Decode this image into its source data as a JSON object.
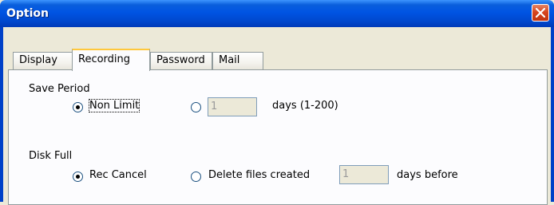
{
  "window": {
    "title": "Option"
  },
  "tabs": [
    {
      "label": "Display",
      "active": false
    },
    {
      "label": "Recording",
      "active": true
    },
    {
      "label": "Password",
      "active": false
    },
    {
      "label": "Mail",
      "active": false
    }
  ],
  "save_period": {
    "heading": "Save Period",
    "option_non_limit": {
      "label": "Non Limit",
      "checked": true
    },
    "option_days": {
      "value": "1",
      "suffix": "days (1-200)",
      "checked": false
    }
  },
  "disk_full": {
    "heading": "Disk Full",
    "option_rec_cancel": {
      "label": "Rec Cancel",
      "checked": true
    },
    "option_delete": {
      "label": "Delete files created",
      "value": "1",
      "suffix": "days before",
      "checked": false
    }
  },
  "icons": {
    "close": "close-icon"
  },
  "colors": {
    "titlebar": "#0054e3",
    "close_button": "#d7451f",
    "tab_highlight": "#ffc83c",
    "dialog_bg": "#ece9d8"
  }
}
